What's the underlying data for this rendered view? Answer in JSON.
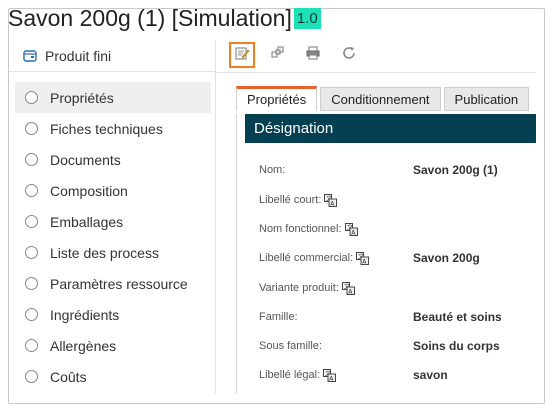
{
  "window": {
    "title": "Savon 200g (1) [Simulation]",
    "version": "1.0"
  },
  "left_panel": {
    "header_label": "Produit fini",
    "items": [
      {
        "label": "Propriétés",
        "active": true
      },
      {
        "label": "Fiches techniques"
      },
      {
        "label": "Documents"
      },
      {
        "label": "Composition"
      },
      {
        "label": "Emballages"
      },
      {
        "label": "Liste des process"
      },
      {
        "label": "Paramètres ressource"
      },
      {
        "label": "Ingrédients"
      },
      {
        "label": "Allergènes"
      },
      {
        "label": "Coûts"
      }
    ]
  },
  "toolbar": {
    "buttons": [
      "edit-icon",
      "copy-icon",
      "print-icon",
      "refresh-icon"
    ],
    "highlighted": "edit-icon"
  },
  "tabs": [
    {
      "label": "Propriétés",
      "active": true
    },
    {
      "label": "Conditionnement"
    },
    {
      "label": "Publication"
    }
  ],
  "section": {
    "title": "Désignation"
  },
  "fields": [
    {
      "label": "Nom:",
      "value": "Savon 200g (1)",
      "translatable": false
    },
    {
      "label": "Libellé court:",
      "value": "",
      "translatable": true
    },
    {
      "label": "Nom fonctionnel:",
      "value": "",
      "translatable": true
    },
    {
      "label": "Libellé commercial:",
      "value": "Savon 200g",
      "translatable": true
    },
    {
      "label": "Variante produit:",
      "value": "",
      "translatable": true
    },
    {
      "label": "Famille:",
      "value": "Beauté et soins",
      "translatable": false
    },
    {
      "label": "Sous famille:",
      "value": "Soins du corps",
      "translatable": false
    },
    {
      "label": "Libellé légal:",
      "value": "savon",
      "translatable": true
    }
  ],
  "colors": {
    "accent": "#e8622a",
    "header_bg": "#053f52",
    "badge": "#1de2b8",
    "highlight": "#f47d20"
  }
}
